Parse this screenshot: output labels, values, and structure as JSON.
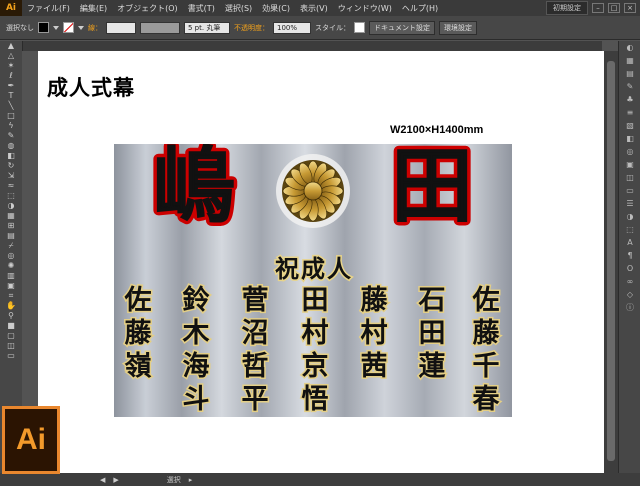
{
  "app": {
    "logo": "Ai"
  },
  "menu": [
    "ファイル(F)",
    "編集(E)",
    "オブジェクト(O)",
    "書式(T)",
    "選択(S)",
    "効果(C)",
    "表示(V)",
    "ウィンドウ(W)",
    "ヘルプ(H)"
  ],
  "workspace": {
    "label": "初期設定"
  },
  "control": {
    "selection_label": "選択なし",
    "stroke_label": "線：",
    "brush_label": "5 pt. 丸筆",
    "opacity_label": "不透明度：",
    "opacity_value": "100%",
    "style_label": "スタイル：",
    "doc_settings": "ドキュメント設定",
    "prefs": "環境設定"
  },
  "artboard": {
    "title": "成人式幕",
    "dimensions": "W2100×H1400mm"
  },
  "banner": {
    "family_left": "嶋",
    "family_right": "田",
    "subtitle": "祝成人",
    "names": [
      "佐藤千春",
      "石田蓮",
      "藤村茜",
      "田村京悟",
      "菅沼哲平",
      "鈴木海斗",
      "佐藤嶺"
    ],
    "crest": "chrysanthemum-crest"
  },
  "status": {
    "tool": "選択"
  },
  "colors": {
    "accent": "#f3a21b",
    "banner_red": "#cc1111",
    "gold": "#c9a84a"
  }
}
